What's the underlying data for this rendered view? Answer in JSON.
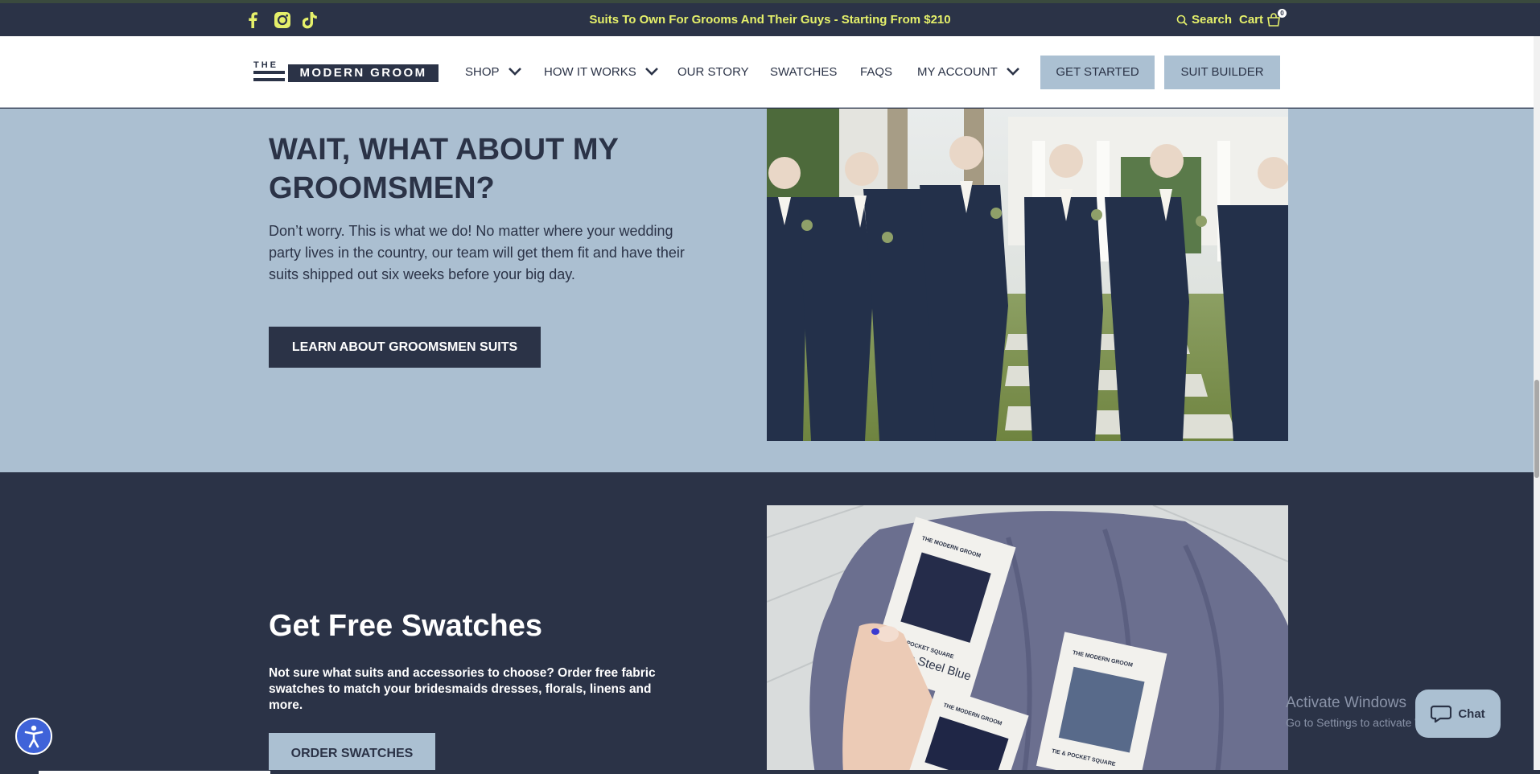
{
  "announcement": {
    "text": "Suits To Own For Grooms And Their Guys - Starting From $210",
    "search_label": "Search",
    "cart_label": "Cart",
    "cart_count": "0",
    "social": [
      "facebook-icon",
      "instagram-icon",
      "tiktok-icon"
    ]
  },
  "logo": {
    "the": "THE",
    "name": "MODERN GROOM"
  },
  "nav": {
    "shop": "SHOP",
    "how_it_works": "HOW IT WORKS",
    "our_story": "OUR STORY",
    "swatches": "SWATCHES",
    "faqs": "FAQS",
    "my_account": "MY ACCOUNT",
    "get_started": "GET STARTED",
    "suit_builder": "SUIT BUILDER"
  },
  "groomsmen": {
    "heading": "WAIT, WHAT ABOUT MY GROOMSMEN?",
    "body": "Don’t worry. This is what we do! No matter where your wedding party lives in the country, our team will get them fit and have their suits shipped out six weeks before your big day.",
    "button": "LEARN ABOUT GROOMSMEN SUITS"
  },
  "swatches": {
    "heading": "Get Free Swatches",
    "body": "Not sure what suits and accessories to choose? Order free fabric swatches to match your bridesmaids dresses, florals, linens and more.",
    "button": "ORDER SWATCHES",
    "card1_brand": "THE MODERN GROOM",
    "card1_type": "TIE & POCKET SQUARE",
    "card1_color": "Deep Steel Blue",
    "card2_brand": "THE MODERN GROOM",
    "card2_type": "TIE & POCKET SQUARE",
    "card3_brand": "THE MODERN GROOM"
  },
  "overlay": {
    "watermark_title": "Activate Windows",
    "watermark_sub": "Go to Settings to activate Windows.",
    "chat_label": "Chat"
  },
  "colors": {
    "navy": "#2b3347",
    "light_blue": "#abbfd1",
    "accent_yellow": "#e5f06a",
    "accessibility_blue": "#3f63d9"
  }
}
